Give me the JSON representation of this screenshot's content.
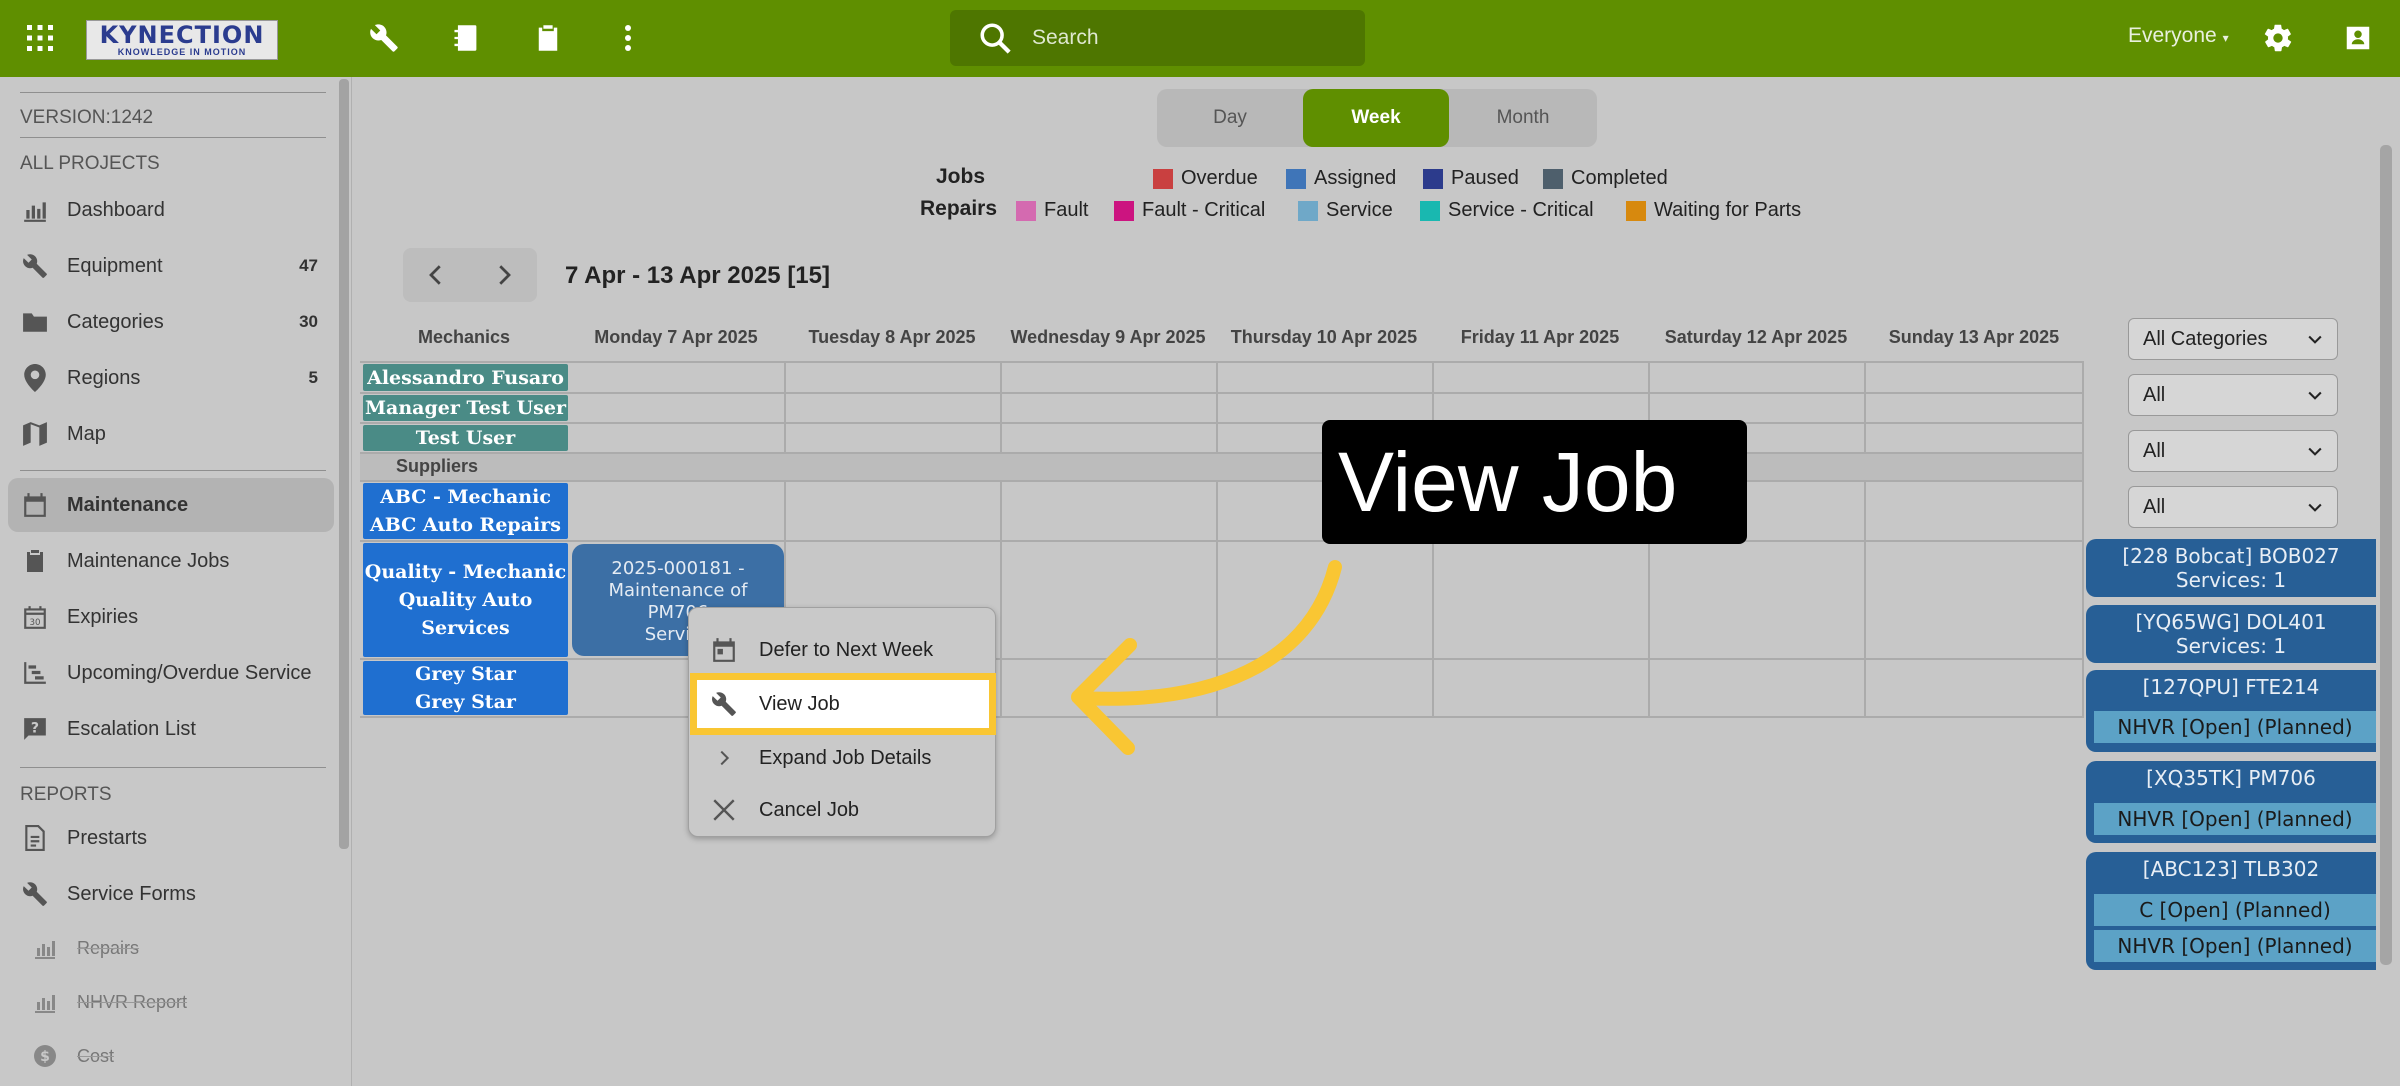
{
  "header": {
    "logo_brand": "KYNECTION",
    "logo_tagline": "KNOWLEDGE IN MOTION",
    "search_placeholder": "Search",
    "user_filter": "Everyone"
  },
  "sidebar": {
    "version": "VERSION:1242",
    "section_projects": "ALL PROJECTS",
    "items": [
      {
        "label": "Dashboard",
        "icon": "chart-icon",
        "count": ""
      },
      {
        "label": "Equipment",
        "icon": "wrench-icon",
        "count": "47"
      },
      {
        "label": "Categories",
        "icon": "folder-icon",
        "count": "30"
      },
      {
        "label": "Regions",
        "icon": "location-pin-icon",
        "count": "5"
      },
      {
        "label": "Map",
        "icon": "map-icon",
        "count": ""
      },
      {
        "label": "Maintenance",
        "icon": "calendar-icon",
        "count": ""
      },
      {
        "label": "Maintenance Jobs",
        "icon": "clipboard-icon",
        "count": ""
      },
      {
        "label": "Expiries",
        "icon": "calendar-30-icon",
        "count": ""
      },
      {
        "label": "Upcoming/Overdue Service",
        "icon": "timeline-icon",
        "count": ""
      },
      {
        "label": "Escalation List",
        "icon": "alert-icon",
        "count": ""
      }
    ],
    "section_reports": "REPORTS",
    "reports": [
      {
        "label": "Prestarts",
        "icon": "document-icon"
      },
      {
        "label": "Service Forms",
        "icon": "wrench-icon"
      },
      {
        "label": "Repairs",
        "icon": "chart-icon"
      },
      {
        "label": "NHVR Report",
        "icon": "chart-icon"
      },
      {
        "label": "Cost",
        "icon": "dollar-icon"
      }
    ]
  },
  "view_toggle": {
    "day": "Day",
    "week": "Week",
    "month": "Month",
    "selected": "Week"
  },
  "legend": {
    "jobs_title": "Jobs",
    "repairs_title": "Repairs",
    "jobs": [
      {
        "label": "Overdue",
        "color": "#c94040"
      },
      {
        "label": "Assigned",
        "color": "#3f75b8"
      },
      {
        "label": "Paused",
        "color": "#2c3b8c"
      },
      {
        "label": "Completed",
        "color": "#4e5f6c"
      }
    ],
    "repairs": [
      {
        "label": "Fault",
        "color": "#d46ab0"
      },
      {
        "label": "Fault - Critical",
        "color": "#cc1480"
      },
      {
        "label": "Service",
        "color": "#6fa8c8"
      },
      {
        "label": "Service - Critical",
        "color": "#19b8b0"
      },
      {
        "label": "Waiting for Parts",
        "color": "#d7890e"
      }
    ]
  },
  "week_range": "7 Apr - 13 Apr 2025 [15]",
  "calendar": {
    "columns": [
      "Mechanics",
      "Monday 7 Apr 2025",
      "Tuesday 8 Apr 2025",
      "Wednesday 9 Apr 2025",
      "Thursday 10 Apr 2025",
      "Friday 11 Apr 2025",
      "Saturday 12 Apr 2025",
      "Sunday 13 Apr 2025"
    ],
    "mechanics": [
      "Alessandro Fusaro",
      "Manager Test User",
      "Test User"
    ],
    "suppliers_label": "Suppliers",
    "suppliers": [
      {
        "line1": "ABC - Mechanic",
        "line2": "ABC Auto Repairs",
        "line3": ""
      },
      {
        "line1": "Quality - Mechanic",
        "line2": "Quality Auto",
        "line3": "Services"
      },
      {
        "line1": "Grey Star",
        "line2": "Grey Star",
        "line3": ""
      }
    ],
    "job_card": {
      "line1": "2025-000181 -",
      "line2": "Maintenance of",
      "line3": "PM706",
      "line4": "Service"
    }
  },
  "context_menu": {
    "items": [
      {
        "label": "Defer to Next Week",
        "icon": "calendar-icon"
      },
      {
        "label": "View Job",
        "icon": "wrench-icon"
      },
      {
        "label": "Expand Job Details",
        "icon": "chevron-right-icon"
      },
      {
        "label": "Cancel Job",
        "icon": "close-icon"
      }
    ]
  },
  "callout": {
    "text": "View Job"
  },
  "right_panel": {
    "filters": [
      "All Categories",
      "All",
      "All",
      "All"
    ],
    "cards": [
      {
        "title": "[228 Bobcat] BOB027",
        "subtitle": "Services: 1"
      },
      {
        "title": "[YQ65WG] DOL401",
        "subtitle": "Services: 1"
      },
      {
        "title": "[127QPU] FTE214",
        "rows": [
          "NHVR [Open] (Planned)"
        ]
      },
      {
        "title": "[XQ35TK] PM706",
        "rows": [
          "NHVR [Open] (Planned)"
        ]
      },
      {
        "title": "[ABC123] TLB302",
        "rows": [
          "C [Open] (Planned)",
          "NHVR [Open] (Planned)"
        ]
      }
    ]
  }
}
